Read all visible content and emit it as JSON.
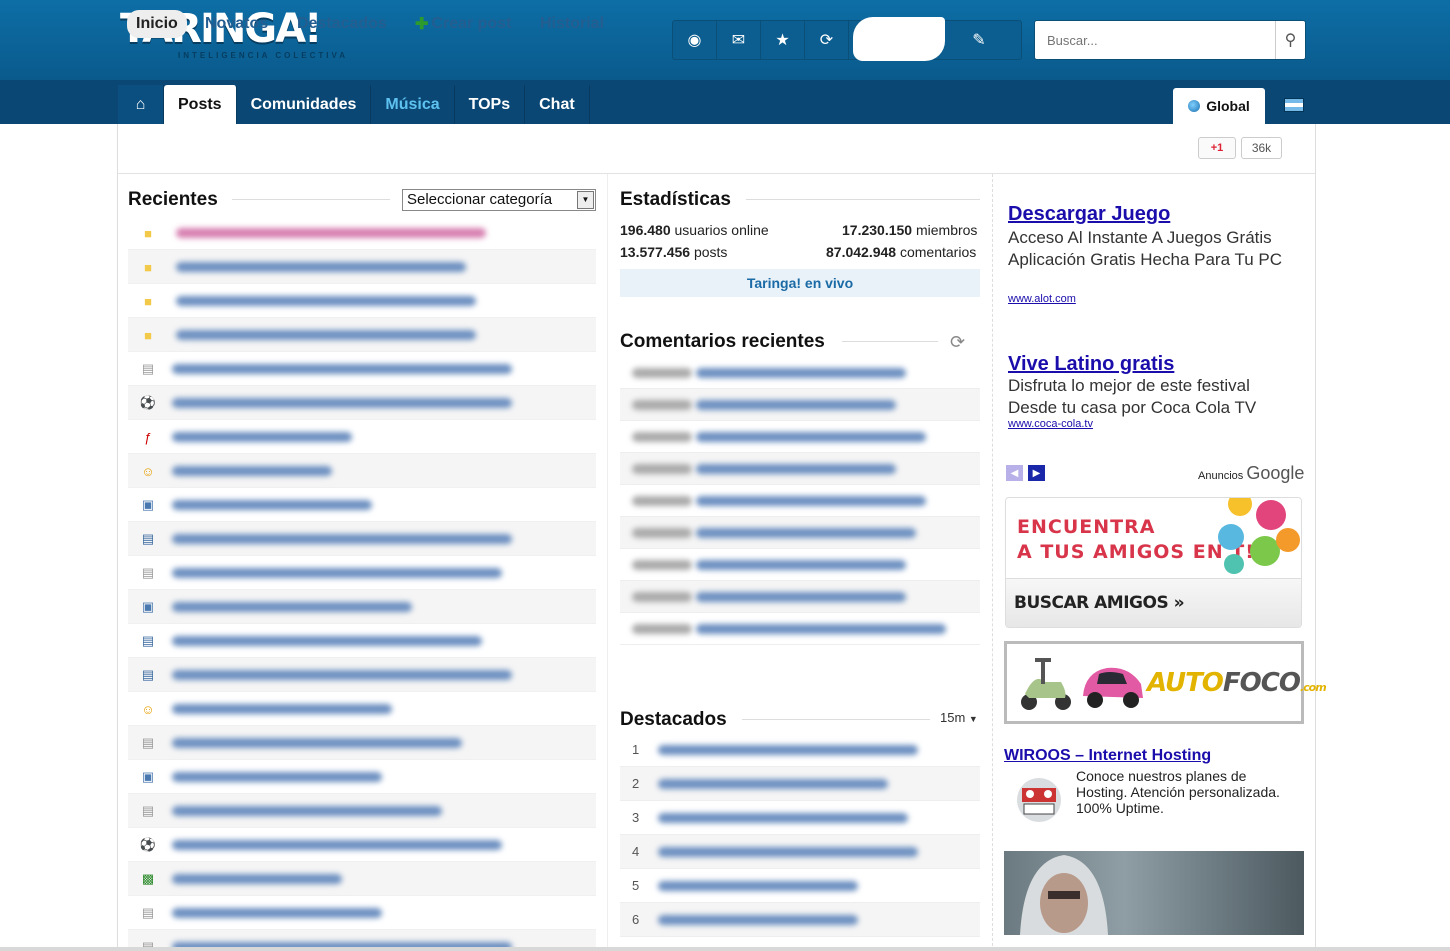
{
  "header": {
    "logo": "TARINGA!",
    "tagline": "INTELIGENCIA COLECTIVA",
    "search_placeholder": "Buscar..."
  },
  "nav": {
    "items": [
      "Posts",
      "Comunidades",
      "Música",
      "TOPs",
      "Chat"
    ],
    "global_label": "Global"
  },
  "subnav": {
    "items": [
      "Inicio",
      "Novatos",
      "Destacados",
      "Crear post",
      "Historial"
    ],
    "gplus_label": "+1",
    "gplus_count": "36k"
  },
  "recientes": {
    "title": "Recientes",
    "category_select": "Seleccionar categoría"
  },
  "estadisticas": {
    "title": "Estadísticas",
    "online_value": "196.480",
    "online_label": "usuarios online",
    "members_value": "17.230.150",
    "members_label": "miembros",
    "posts_value": "13.577.456",
    "posts_label": "posts",
    "comments_value": "87.042.948",
    "comments_label": "comentarios",
    "live_label": "Taringa! en vivo"
  },
  "comentarios": {
    "title": "Comentarios recientes"
  },
  "destacados": {
    "title": "Destacados",
    "period": "15m",
    "numbers": [
      "1",
      "2",
      "3",
      "4",
      "5",
      "6"
    ]
  },
  "ads": {
    "ad1": {
      "title": "Descargar Juego",
      "text": "Acceso Al Instante A Juegos Grátis Aplicación Gratis Hecha Para Tu PC",
      "url": "www.alot.com"
    },
    "ad2": {
      "title": "Vive Latino gratis",
      "text": "Disfruta lo mejor de este festival Desde tu casa por Coca Cola TV",
      "url": "www.coca-cola.tv"
    },
    "anuncios_label": "Anuncios",
    "google_label": "Google",
    "amigos_line1": "ENCUENTRA",
    "amigos_line2": "A TUS AMIGOS EN T!",
    "amigos_button": "BUSCAR AMIGOS »",
    "autofoco_a": "AUTO",
    "autofoco_b": "FOCO",
    "autofoco_c": ".com",
    "wiroos_title": "WIROOS – Internet Hosting",
    "wiroos_text": "Conoce nuestros planes de Hosting. Atención personalizada. 100% Uptime."
  }
}
